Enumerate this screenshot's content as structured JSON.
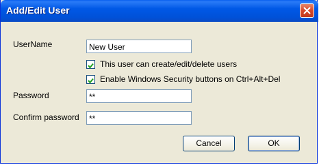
{
  "window": {
    "title": "Add/Edit User"
  },
  "form": {
    "username_label": "UserName",
    "username_value": "New User",
    "checkbox_admin_label": "This user can create/edit/delete users",
    "checkbox_admin_checked": true,
    "checkbox_security_label": "Enable Windows Security buttons on Ctrl+Alt+Del",
    "checkbox_security_checked": true,
    "password_label": "Password",
    "password_value": "**",
    "confirm_label": "Confirm password",
    "confirm_value": "**"
  },
  "buttons": {
    "cancel": "Cancel",
    "ok": "OK"
  },
  "colors": {
    "title_bar": "#0058e6",
    "dialog_bg": "#ece9d8",
    "close_btn": "#d5472a"
  }
}
